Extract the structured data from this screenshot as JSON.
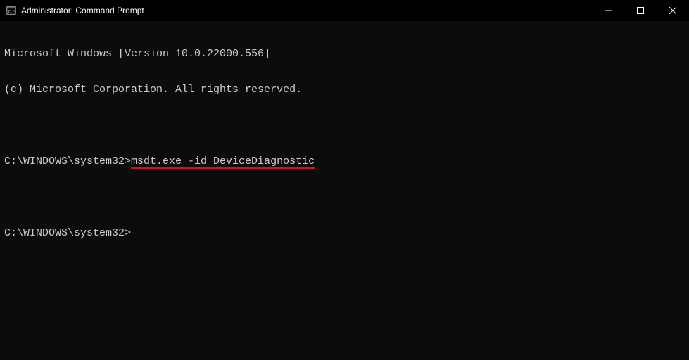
{
  "titlebar": {
    "title": "Administrator: Command Prompt"
  },
  "terminal": {
    "banner_line1": "Microsoft Windows [Version 10.0.22000.556]",
    "banner_line2": "(c) Microsoft Corporation. All rights reserved.",
    "prompt1_path": "C:\\WINDOWS\\system32>",
    "prompt1_cmd": "msdt.exe -id DeviceDiagnostic",
    "prompt2_path": "C:\\WINDOWS\\system32>",
    "annotation_color": "#d60e1f"
  }
}
